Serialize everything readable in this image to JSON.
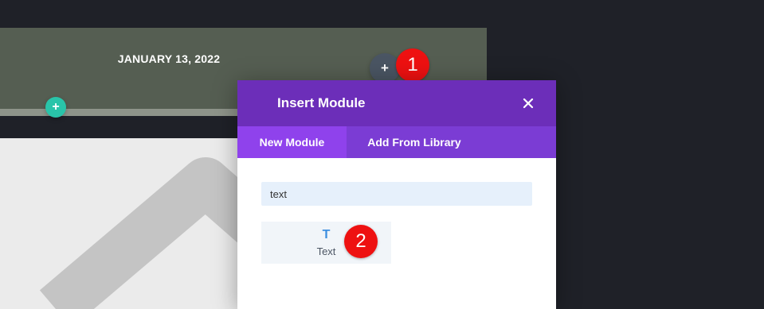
{
  "page": {
    "date": "JANUARY 13, 2022",
    "add_row_button": {
      "symbol": "+",
      "color": "#29c4a9"
    },
    "add_module_button": {
      "symbol": "+",
      "color": "#4a5563"
    }
  },
  "callouts": [
    {
      "number": "1",
      "color": "#ee1111"
    },
    {
      "number": "2",
      "color": "#ee1111"
    }
  ],
  "modal": {
    "title": "Insert Module",
    "close_icon": "close-icon",
    "header_color": "#6c2eb9",
    "tab_bar_color": "#7b3cd4",
    "tabs": [
      {
        "label": "New Module",
        "active": true,
        "color": "#8f42ec"
      },
      {
        "label": "Add From Library",
        "active": false
      }
    ],
    "search": {
      "value": "text",
      "placeholder": ""
    },
    "results": [
      {
        "icon": "text-module-icon",
        "icon_glyph": "T",
        "label": "Text"
      }
    ]
  }
}
